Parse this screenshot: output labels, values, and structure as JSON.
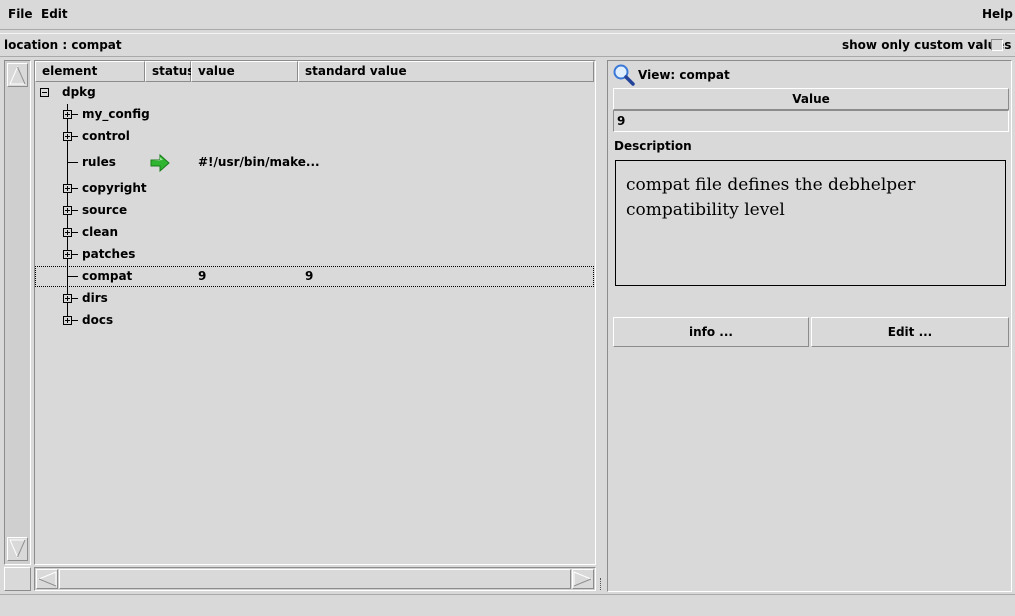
{
  "menu": {
    "file": "File",
    "edit": "Edit",
    "help": "Help"
  },
  "location": {
    "label": "location : compat"
  },
  "custom_toggle": {
    "label": "show only custom values"
  },
  "tree": {
    "columns": [
      "element",
      "status",
      "value",
      "standard value"
    ],
    "root": "dpkg",
    "nodes": [
      {
        "label": "my_config",
        "expandable": true,
        "value": "",
        "standard": ""
      },
      {
        "label": "control",
        "expandable": true,
        "value": "",
        "standard": ""
      },
      {
        "label": "rules",
        "expandable": false,
        "value": "#!/usr/bin/make...",
        "standard": "",
        "status": "arrow"
      },
      {
        "label": "copyright",
        "expandable": true,
        "value": "",
        "standard": ""
      },
      {
        "label": "source",
        "expandable": true,
        "value": "",
        "standard": ""
      },
      {
        "label": "clean",
        "expandable": true,
        "value": "",
        "standard": ""
      },
      {
        "label": "patches",
        "expandable": true,
        "value": "",
        "standard": ""
      },
      {
        "label": "compat",
        "expandable": false,
        "value": "9",
        "standard": "9",
        "selected": true
      },
      {
        "label": "dirs",
        "expandable": true,
        "value": "",
        "standard": ""
      },
      {
        "label": "docs",
        "expandable": true,
        "value": "",
        "standard": ""
      }
    ]
  },
  "view": {
    "title": "View: compat",
    "value_header": "Value",
    "value": "9",
    "description_label": "Description",
    "description": "compat file defines the debhelper compatibility level",
    "info_button": "info ...",
    "edit_button": "Edit ..."
  },
  "colors": {
    "bg": "#d9d9d9",
    "arrow": "#2fb52f",
    "magnifier": "#3a78d8"
  },
  "icons": {
    "status_arrow": "green-arrow-icon",
    "view": "magnifier-icon"
  }
}
